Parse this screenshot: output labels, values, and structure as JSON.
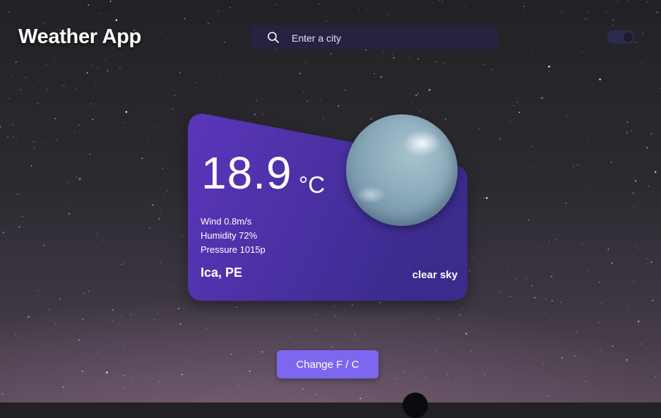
{
  "header": {
    "title": "Weather App"
  },
  "search": {
    "placeholder": "Enter a city",
    "value": "",
    "icon": "search-icon"
  },
  "theme_toggle": {
    "state": "on",
    "icon": "toggle-switch"
  },
  "weather": {
    "temperature": "18.9",
    "unit": "°C",
    "wind": "Wind 0.8m/s",
    "humidity": "Humidity 72%",
    "pressure": "Pressure 1015p",
    "location": "Ica, PE",
    "description": "clear sky",
    "icon": "clear-sky-orb-icon"
  },
  "actions": {
    "change_units_label": "Change F / C"
  },
  "colors": {
    "card_start": "#5a35b8",
    "card_end": "#3b2a8a",
    "button": "#7b68ee",
    "search_bg": "#25233f"
  }
}
